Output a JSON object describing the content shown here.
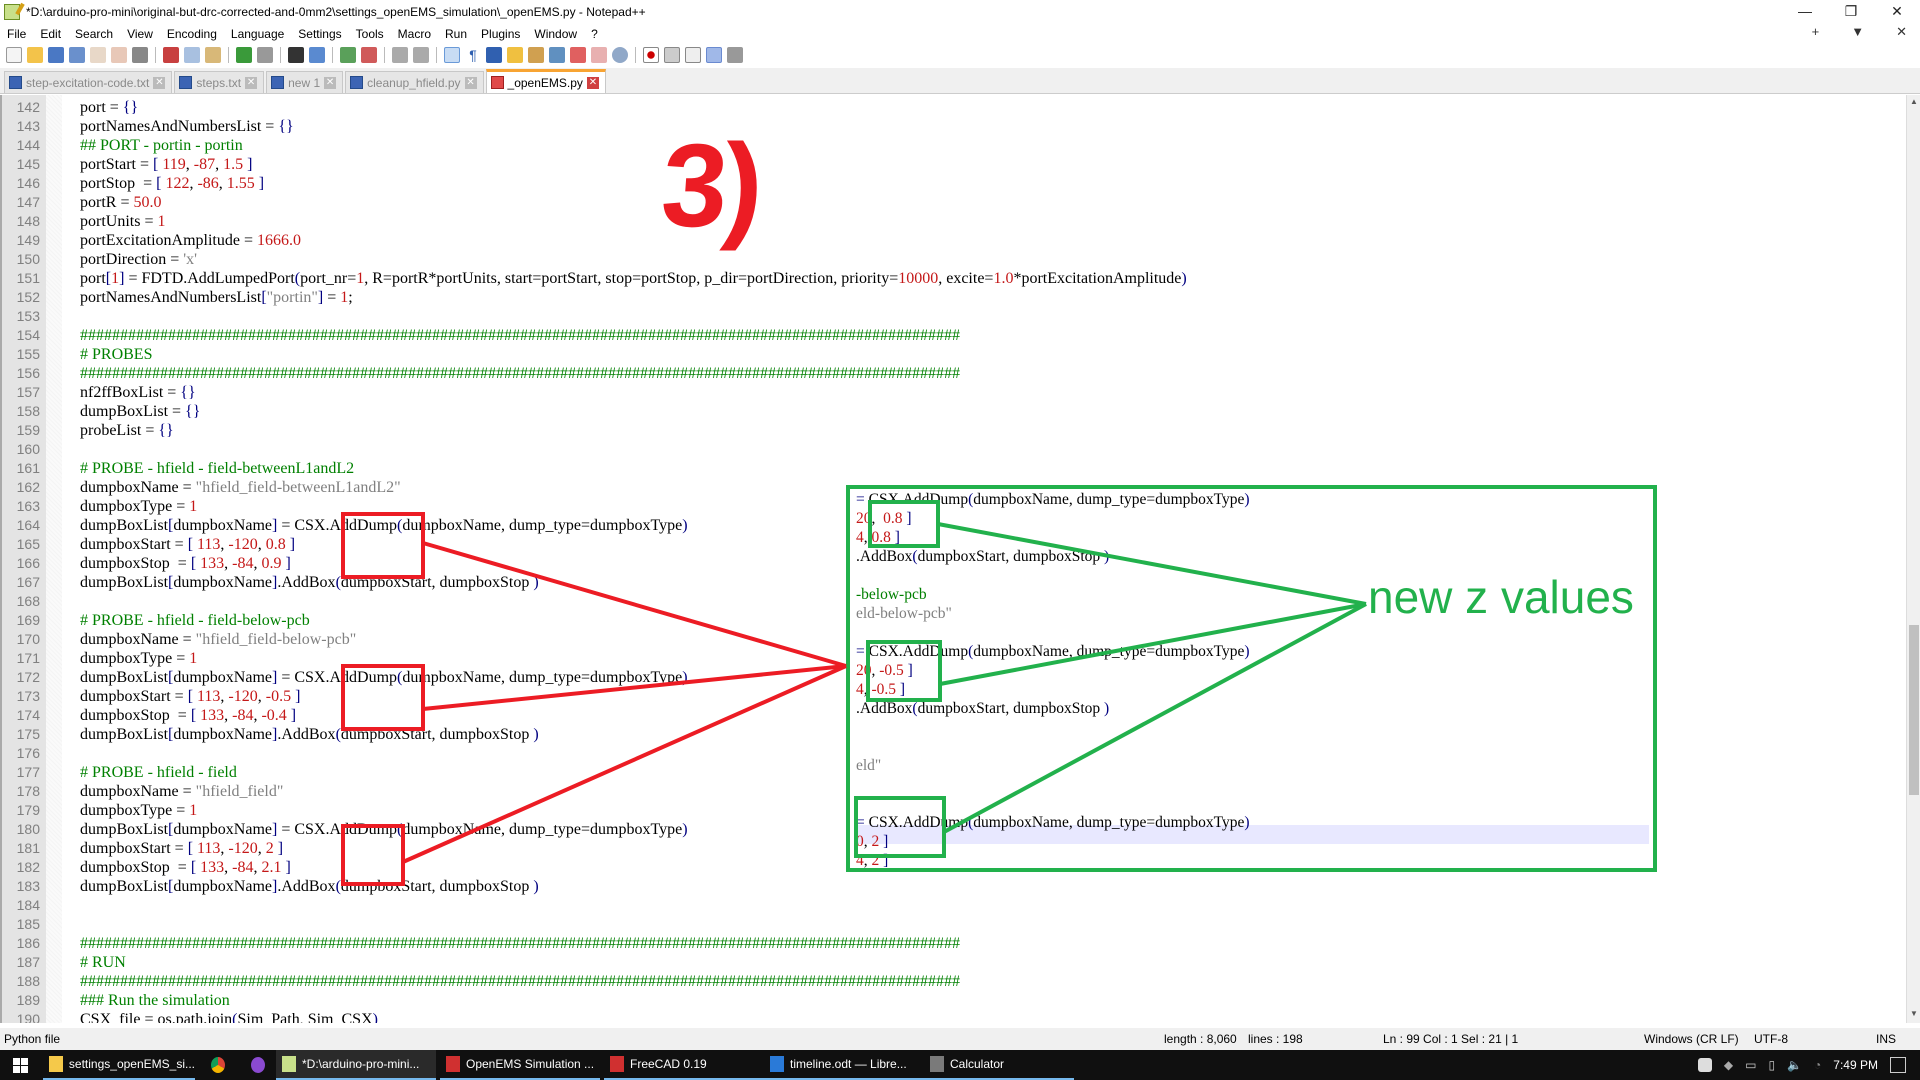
{
  "window": {
    "title": "*D:\\arduino-pro-mini\\original-but-drc-corrected-and-0mm2\\settings_openEMS_simulation\\_openEMS.py - Notepad++",
    "controls": {
      "minimize": "—",
      "maximize": "❐",
      "close": "✕"
    }
  },
  "menu": {
    "items": [
      "File",
      "Edit",
      "Search",
      "View",
      "Encoding",
      "Language",
      "Settings",
      "Tools",
      "Macro",
      "Run",
      "Plugins",
      "Window",
      "?"
    ],
    "right_controls": [
      "+",
      "▼",
      "✕"
    ]
  },
  "toolbar": {
    "icons": [
      "new-file-icon",
      "open-file-icon",
      "save-icon",
      "save-all-icon",
      "close-icon",
      "close-all-icon",
      "print-icon",
      "cut-icon",
      "copy-icon",
      "paste-icon",
      "undo-icon",
      "redo-icon",
      "find-icon",
      "replace-icon",
      "zoom-in-icon",
      "zoom-out-icon",
      "sync-vertical-icon",
      "sync-horizontal-icon",
      "word-wrap-icon",
      "show-all-chars-icon",
      "indent-guide-icon",
      "udl-icon",
      "doc-map-icon",
      "doc-list-icon",
      "function-list-icon",
      "folder-workspace-icon",
      "monitoring-icon",
      "record-macro-icon",
      "stop-macro-icon",
      "play-macro-icon",
      "run-macro-multiple-icon",
      "save-macro-icon"
    ]
  },
  "tabs": [
    {
      "label": "step-excitation-code.txt",
      "active": false
    },
    {
      "label": "steps.txt",
      "active": false
    },
    {
      "label": "new 1",
      "active": false
    },
    {
      "label": "cleanup_hfield.py",
      "active": false
    },
    {
      "label": "_openEMS.py",
      "active": true
    }
  ],
  "editor": {
    "lines": [
      {
        "n": "142",
        "html": "port = <span class='op'>{}</span>"
      },
      {
        "n": "143",
        "html": "portNamesAndNumbersList = <span class='op'>{}</span>"
      },
      {
        "n": "144",
        "html": "<span class='cm'>## PORT - portin - portin</span>"
      },
      {
        "n": "145",
        "html": "portStart = <span class='op'>[</span> <span class='num'>119</span>, <span class='num'>-87</span>, <span class='num'>1.5</span> <span class='op'>]</span>"
      },
      {
        "n": "146",
        "html": "portStop  = <span class='op'>[</span> <span class='num'>122</span>, <span class='num'>-86</span>, <span class='num'>1.55</span> <span class='op'>]</span>"
      },
      {
        "n": "147",
        "html": "portR = <span class='num'>50.0</span>"
      },
      {
        "n": "148",
        "html": "portUnits = <span class='num'>1</span>"
      },
      {
        "n": "149",
        "html": "portExcitationAmplitude = <span class='num'>1666.0</span>"
      },
      {
        "n": "150",
        "html": "portDirection = <span class='str'>'x'</span>"
      },
      {
        "n": "151",
        "html": "port<span class='op'>[</span><span class='num'>1</span><span class='op'>]</span> = FDTD.AddLumpedPort<span class='op'>(</span>port_nr=<span class='num'>1</span>, R=portR*portUnits, start=portStart, stop=portStop, p_dir=portDirection, priority=<span class='num'>10000</span>, excite=<span class='num'>1.0</span>*portExcitationAmplitude<span class='op'>)</span>"
      },
      {
        "n": "152",
        "html": "portNamesAndNumbersList<span class='op'>[</span><span class='str'>\"portin\"</span><span class='op'>]</span> = <span class='num'>1</span>;"
      },
      {
        "n": "153",
        "html": ""
      },
      {
        "n": "154",
        "html": "<span class='cm'>##############################################################################################################</span>"
      },
      {
        "n": "155",
        "html": "<span class='cm'># PROBES</span>"
      },
      {
        "n": "156",
        "html": "<span class='cm'>##############################################################################################################</span>"
      },
      {
        "n": "157",
        "html": "nf2ffBoxList = <span class='op'>{}</span>"
      },
      {
        "n": "158",
        "html": "dumpBoxList = <span class='op'>{}</span>"
      },
      {
        "n": "159",
        "html": "probeList = <span class='op'>{}</span>"
      },
      {
        "n": "160",
        "html": ""
      },
      {
        "n": "161",
        "html": "<span class='cm'># PROBE - hfield - field-betweenL1andL2</span>"
      },
      {
        "n": "162",
        "html": "dumpboxName = <span class='str'>\"hfield_field-betweenL1andL2\"</span>"
      },
      {
        "n": "163",
        "html": "dumpboxType = <span class='num'>1</span>"
      },
      {
        "n": "164",
        "html": "dumpBoxList<span class='op'>[</span>dumpboxName<span class='op'>]</span> = CSX.AddDump<span class='op'>(</span>dumpboxName, dump_type=dumpboxType<span class='op'>)</span>"
      },
      {
        "n": "165",
        "html": "dumpboxStart = <span class='op'>[</span> <span class='num'>113</span>, <span class='num'>-120</span>, <span class='num'>0.8</span> <span class='op'>]</span>"
      },
      {
        "n": "166",
        "html": "dumpboxStop  = <span class='op'>[</span> <span class='num'>133</span>, <span class='num'>-84</span>, <span class='num'>0.9</span> <span class='op'>]</span>"
      },
      {
        "n": "167",
        "html": "dumpBoxList<span class='op'>[</span>dumpboxName<span class='op'>]</span>.AddBox<span class='op'>(</span>dumpboxStart, dumpboxStop <span class='op'>)</span>"
      },
      {
        "n": "168",
        "html": ""
      },
      {
        "n": "169",
        "html": "<span class='cm'># PROBE - hfield - field-below-pcb</span>"
      },
      {
        "n": "170",
        "html": "dumpboxName = <span class='str'>\"hfield_field-below-pcb\"</span>"
      },
      {
        "n": "171",
        "html": "dumpboxType = <span class='num'>1</span>"
      },
      {
        "n": "172",
        "html": "dumpBoxList<span class='op'>[</span>dumpboxName<span class='op'>]</span> = CSX.AddDump<span class='op'>(</span>dumpboxName, dump_type=dumpboxType<span class='op'>)</span>"
      },
      {
        "n": "173",
        "html": "dumpboxStart = <span class='op'>[</span> <span class='num'>113</span>, <span class='num'>-120</span>, <span class='num'>-0.5</span> <span class='op'>]</span>"
      },
      {
        "n": "174",
        "html": "dumpboxStop  = <span class='op'>[</span> <span class='num'>133</span>, <span class='num'>-84</span>, <span class='num'>-0.4</span> <span class='op'>]</span>"
      },
      {
        "n": "175",
        "html": "dumpBoxList<span class='op'>[</span>dumpboxName<span class='op'>]</span>.AddBox<span class='op'>(</span>dumpboxStart, dumpboxStop <span class='op'>)</span>"
      },
      {
        "n": "176",
        "html": ""
      },
      {
        "n": "177",
        "html": "<span class='cm'># PROBE - hfield - field</span>"
      },
      {
        "n": "178",
        "html": "dumpboxName = <span class='str'>\"hfield_field\"</span>"
      },
      {
        "n": "179",
        "html": "dumpboxType = <span class='num'>1</span>"
      },
      {
        "n": "180",
        "html": "dumpBoxList<span class='op'>[</span>dumpboxName<span class='op'>]</span> = CSX.AddDump<span class='op'>(</span>dumpboxName, dump_type=dumpboxType<span class='op'>)</span>"
      },
      {
        "n": "181",
        "html": "dumpboxStart = <span class='op'>[</span> <span class='num'>113</span>, <span class='num'>-120</span>, <span class='num'>2</span> <span class='op'>]</span>"
      },
      {
        "n": "182",
        "html": "dumpboxStop  = <span class='op'>[</span> <span class='num'>133</span>, <span class='num'>-84</span>, <span class='num'>2.1</span> <span class='op'>]</span>"
      },
      {
        "n": "183",
        "html": "dumpBoxList<span class='op'>[</span>dumpboxName<span class='op'>]</span>.AddBox<span class='op'>(</span>dumpboxStart, dumpboxStop <span class='op'>)</span>"
      },
      {
        "n": "184",
        "html": ""
      },
      {
        "n": "185",
        "html": ""
      },
      {
        "n": "186",
        "html": "<span class='cm'>##############################################################################################################</span>"
      },
      {
        "n": "187",
        "html": "<span class='cm'># RUN</span>"
      },
      {
        "n": "188",
        "html": "<span class='cm'>##############################################################################################################</span>"
      },
      {
        "n": "189",
        "html": "<span class='cm'>### Run the simulation</span>"
      },
      {
        "n": "190",
        "html": "CSX_file = os.path.join<span class='op'>(</span>Sim_Path, Sim_CSX<span class='op'>)</span>"
      }
    ]
  },
  "annotation": {
    "step_label": "3)",
    "callout_label": "new z values",
    "inset_lines": [
      {
        "html": "<span class='op'>=</span> CSX.AddDump<span class='op'>(</span>dumpboxName, dump_type=dumpboxType<span class='op'>)</span>"
      },
      {
        "html": "<span class='num'>20</span>,  <span class='num'>0.8</span> <span class='op'>]</span>"
      },
      {
        "html": "<span class='num'>4</span>, <span class='num'>0.8</span> <span class='op'>]</span>"
      },
      {
        "html": ".AddBox<span class='op'>(</span>dumpboxStart, dumpboxStop <span class='op'>)</span>"
      },
      {
        "html": ""
      },
      {
        "html": "<span class='cm'>-below-pcb</span>"
      },
      {
        "html": "<span class='str'>eld-below-pcb\"</span>"
      },
      {
        "html": ""
      },
      {
        "html": "<span class='op'>=</span> CSX.AddDump<span class='op'>(</span>dumpboxName, dump_type=dumpboxType<span class='op'>)</span>"
      },
      {
        "html": "<span class='num'>20</span>, <span class='num'>-0.5</span> <span class='op'>]</span>"
      },
      {
        "html": "<span class='num'>4</span>, <span class='num'>-0.5</span> <span class='op'>]</span>"
      },
      {
        "html": ".AddBox<span class='op'>(</span>dumpboxStart, dumpboxStop <span class='op'>)</span>"
      },
      {
        "html": ""
      },
      {
        "html": ""
      },
      {
        "html": "<span class='str'>eld\"</span>"
      },
      {
        "html": ""
      },
      {
        "html": ""
      },
      {
        "html": "<span class='op'>=</span> CSX.AddDump<span class='op'>(</span>dumpboxName, dump_type=dumpboxType<span class='op'>)</span>"
      },
      {
        "html": "<span class='num'>0</span>, <span class='num'>2</span> <span class='op'>]</span>"
      },
      {
        "html": "<span class='num'>4</span>, <span class='num'>2</span> <span class='op'>]</span>"
      },
      {
        "html": ".AddBox<span class='op'>(</span>dumpboxStart, dumpboxStop <span class='op'>)</span>"
      }
    ],
    "colors": {
      "old_values": "#ec1c24",
      "new_values": "#22b14c"
    }
  },
  "statusbar": {
    "file_type": "Python file",
    "length": "length : 8,060",
    "lines": "lines : 198",
    "position": "Ln : 99    Col : 1    Sel : 21 | 1",
    "eol": "Windows (CR LF)",
    "encoding": "UTF-8",
    "mode": "INS"
  },
  "taskbar": {
    "items": [
      {
        "label": "settings_openEMS_si...",
        "icon": "folder-icon"
      },
      {
        "label": "",
        "icon": "chrome-icon"
      },
      {
        "label": "",
        "icon": "app-icon"
      },
      {
        "label": "*D:\\arduino-pro-mini...",
        "icon": "notepadpp-icon",
        "active": true
      },
      {
        "label": "OpenEMS Simulation ...",
        "icon": "freecad-icon"
      },
      {
        "label": "FreeCAD 0.19",
        "icon": "freecad-icon"
      },
      {
        "label": "timeline.odt — Libre...",
        "icon": "writer-icon"
      },
      {
        "label": "Calculator",
        "icon": "calculator-icon"
      }
    ],
    "clock": "7:49 PM"
  }
}
